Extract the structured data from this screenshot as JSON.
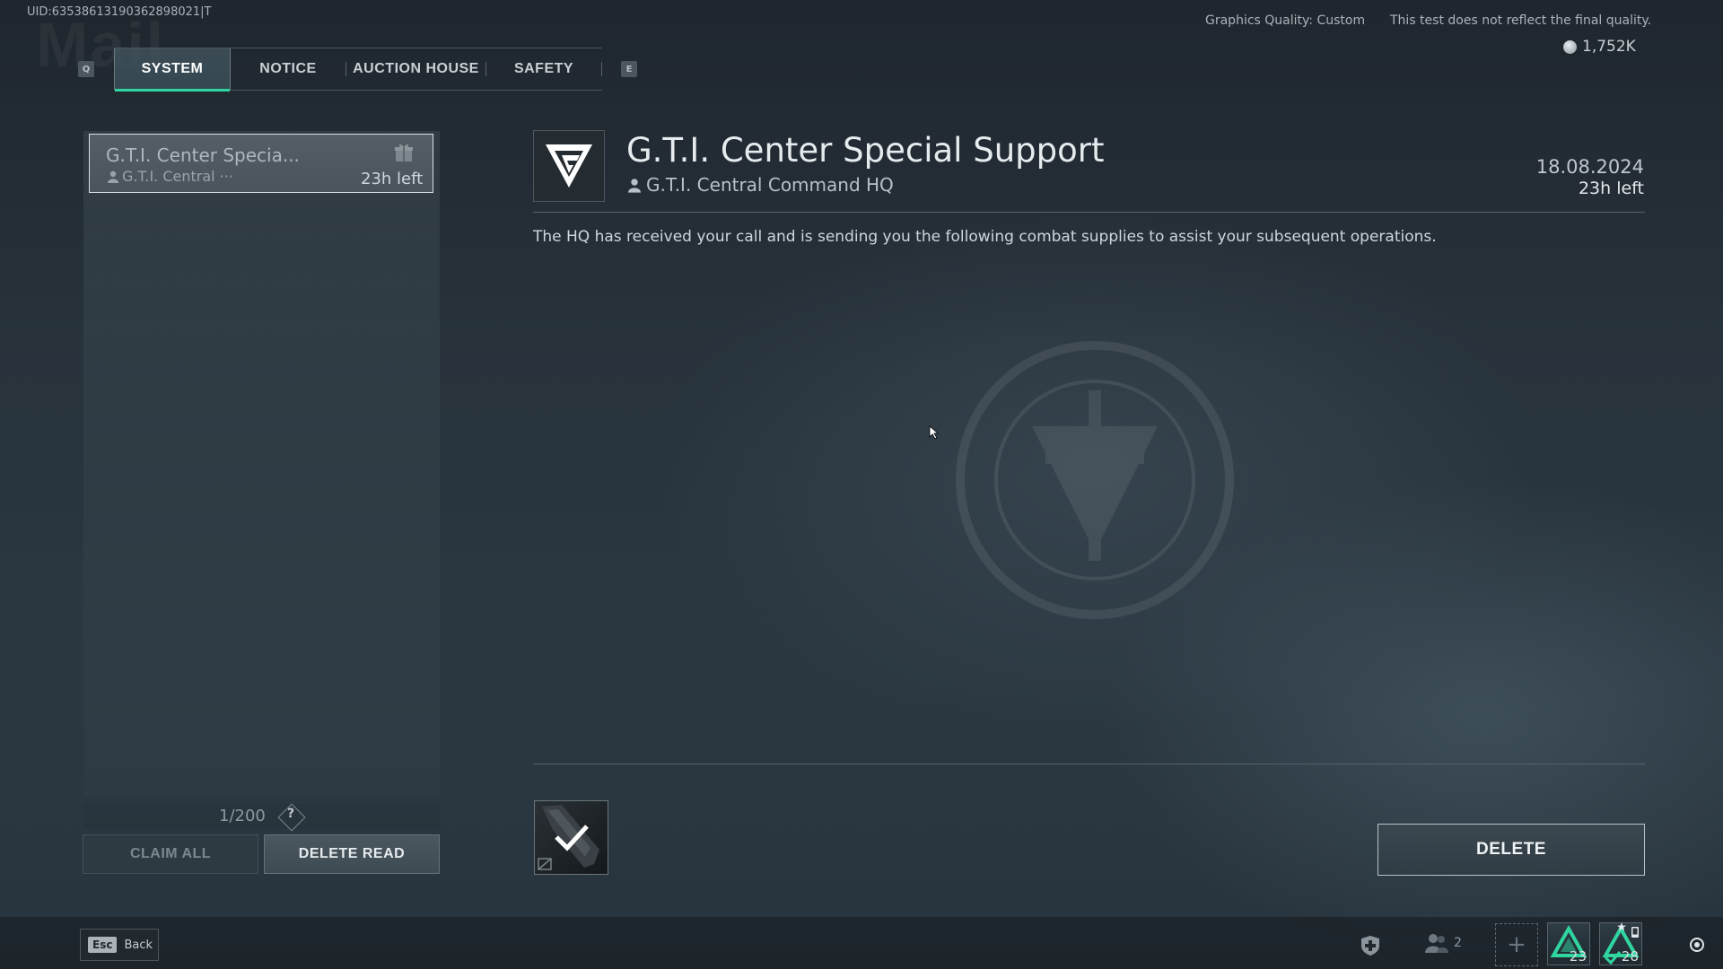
{
  "header": {
    "uid": "UID:6353861319036289802​1|T",
    "ghost_title": "Mail",
    "graphics_quality": "Graphics Quality: Custom",
    "test_notice": "This test does not reflect the final quality.",
    "currency_amount": "1,752K"
  },
  "tabs": {
    "prev_key": "Q",
    "next_key": "E",
    "items": [
      {
        "label": "SYSTEM",
        "active": true
      },
      {
        "label": "NOTICE",
        "active": false
      },
      {
        "label": "AUCTION HOUSE",
        "active": false
      },
      {
        "label": "SAFETY",
        "active": false
      }
    ]
  },
  "mail_list": {
    "items": [
      {
        "title": "G.T.I. Center Specia...",
        "sender": "G.T.I. Central ···",
        "time_left": "23h left"
      }
    ],
    "counter": "1/200",
    "help": "?",
    "claim_all_label": "CLAIM ALL",
    "delete_read_label": "DELETE READ"
  },
  "mail_detail": {
    "title": "G.T.I. Center Special Support",
    "sender": "G.T.I. Central Command HQ",
    "date": "18.08.2024",
    "time_left": "23h left",
    "body": "The HQ has received your call and is sending you the following combat supplies to assist your subsequent operations.",
    "attachment_claimed": true,
    "delete_label": "DELETE"
  },
  "bottom_bar": {
    "esc_key": "Esc",
    "back_label": "Back",
    "friends_count": "2",
    "empty_slot": "+",
    "slot_a_number": "23",
    "slot_b_number": "28"
  },
  "colors": {
    "accent": "#2fd6a0",
    "background": "#27323b"
  }
}
